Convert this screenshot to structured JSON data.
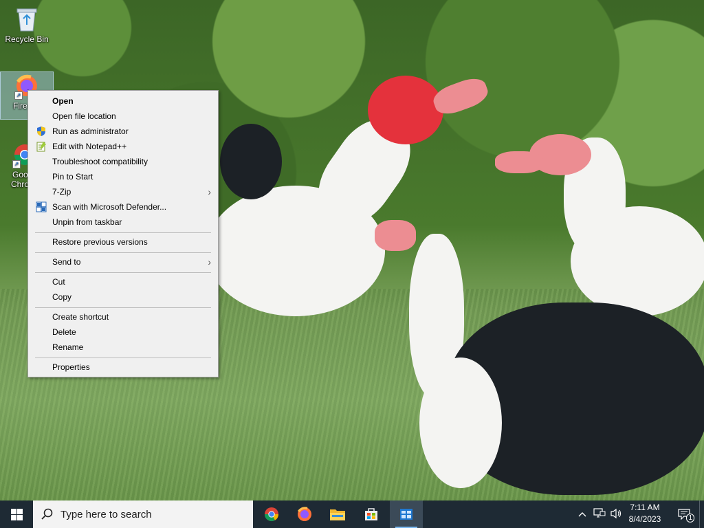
{
  "desktop": {
    "icons": [
      {
        "label": "Recycle Bin",
        "icon": "recycle-bin-icon"
      },
      {
        "label": "Fire",
        "icon": "firefox-icon",
        "selected": true
      },
      {
        "label": "Goo",
        "label2": "Chro",
        "icon": "chrome-icon"
      }
    ]
  },
  "context_menu": {
    "items": [
      {
        "label": "Open",
        "bold": true
      },
      {
        "label": "Open file location"
      },
      {
        "label": "Run as administrator",
        "icon": "uac-shield-icon"
      },
      {
        "label": "Edit with Notepad++",
        "icon": "notepadpp-icon"
      },
      {
        "label": "Troubleshoot compatibility"
      },
      {
        "label": "Pin to Start"
      },
      {
        "label": "7-Zip",
        "submenu": true
      },
      {
        "label": "Scan with Microsoft Defender...",
        "icon": "defender-icon"
      },
      {
        "label": "Unpin from taskbar"
      },
      {
        "label": "Restore previous versions"
      },
      {
        "label": "Send to",
        "submenu": true
      },
      {
        "label": "Cut"
      },
      {
        "label": "Copy"
      },
      {
        "label": "Create shortcut"
      },
      {
        "label": "Delete"
      },
      {
        "label": "Rename"
      },
      {
        "label": "Properties"
      }
    ],
    "submenu_arrow": "›"
  },
  "taskbar": {
    "search_placeholder": "Type here to search",
    "pinned": [
      {
        "name": "chrome-icon"
      },
      {
        "name": "firefox-icon"
      },
      {
        "name": "file-explorer-icon"
      },
      {
        "name": "store-icon"
      },
      {
        "name": "app-icon",
        "active": true
      }
    ],
    "clock": {
      "time": "7:11 AM",
      "date": "8/4/2023"
    },
    "notification_count": "1"
  },
  "colors": {
    "taskbar": "#1e2a34",
    "menu_bg": "#f0f0f0",
    "accent": "#7ab8f0"
  }
}
